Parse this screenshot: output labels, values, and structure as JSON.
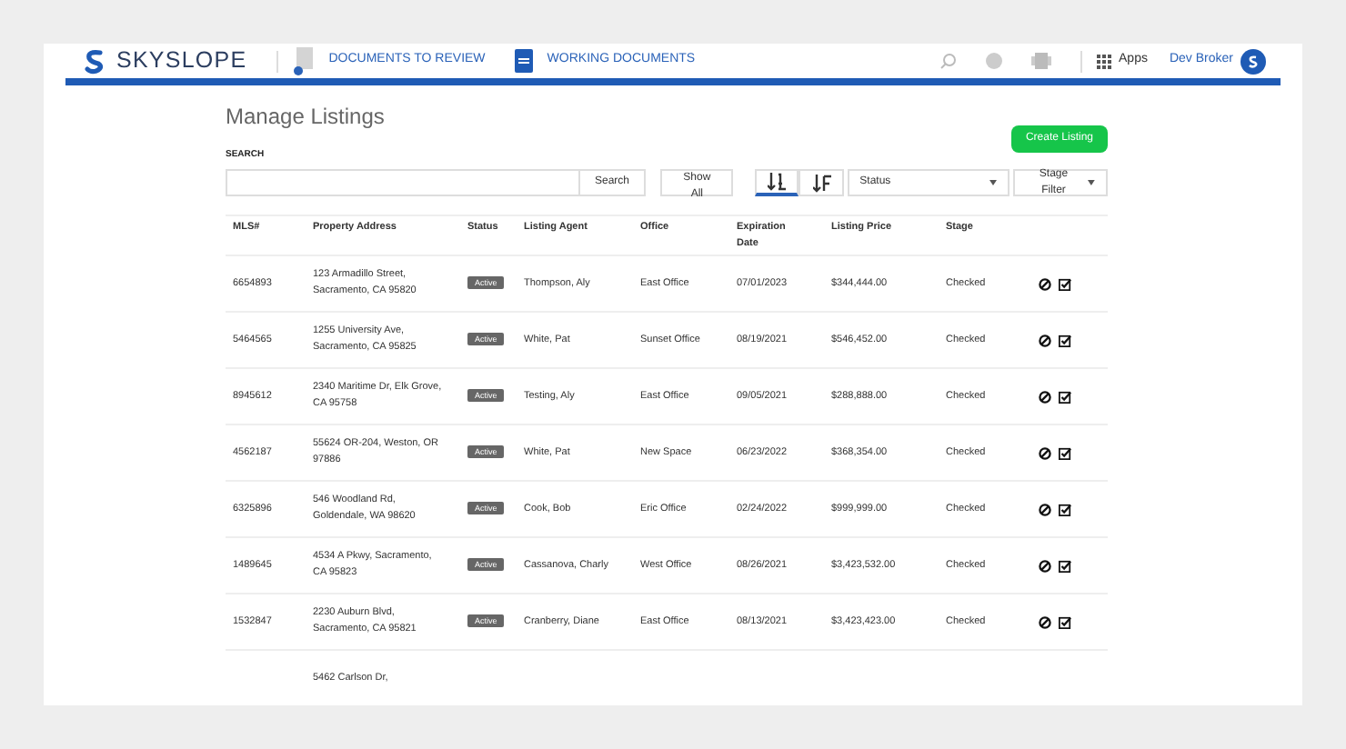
{
  "header": {
    "logo": "SKYSLOPE",
    "nav": [
      {
        "label": "DOCUMENTS TO REVIEW",
        "kind": "review"
      },
      {
        "label": "WORKING DOCUMENTS",
        "kind": "working"
      }
    ],
    "apps": "Apps",
    "user": "Dev Broker"
  },
  "page": {
    "title": "Manage Listings",
    "create_button": "Create Listing",
    "search_label": "SEARCH",
    "search_button": "Search",
    "show_all": "Show All",
    "sort_buttons": [
      {
        "kind": "asc",
        "selected": true
      },
      {
        "kind": "desc",
        "selected": false
      }
    ],
    "status_select": "Status",
    "stage_filter": "Stage Filter"
  },
  "table": {
    "columns": [
      [
        "MLS#"
      ],
      [
        "Property Address"
      ],
      [
        "Status"
      ],
      [
        "Listing Agent"
      ],
      [
        "Office"
      ],
      [
        "Expiration",
        "Date"
      ],
      [
        "Listing Price"
      ],
      [
        "Stage"
      ]
    ],
    "rows": [
      {
        "mls": "6654893",
        "address": [
          "123 Armadillo Street,",
          "Sacramento, CA 95820"
        ],
        "status": "Active",
        "agent": "Thompson, Aly",
        "office": "East Office",
        "expiration": "07/01/2023",
        "price": "$344,444.00",
        "stage": "Checked"
      },
      {
        "mls": "5464565",
        "address": [
          "1255 University Ave,",
          "Sacramento, CA 95825"
        ],
        "status": "Active",
        "agent": "White, Pat",
        "office": "Sunset Office",
        "expiration": "08/19/2021",
        "price": "$546,452.00",
        "stage": "Checked"
      },
      {
        "mls": "8945612",
        "address": [
          "2340 Maritime Dr, Elk Grove,",
          "CA 95758"
        ],
        "status": "Active",
        "agent": "Testing, Aly",
        "office": "East Office",
        "expiration": "09/05/2021",
        "price": "$288,888.00",
        "stage": "Checked"
      },
      {
        "mls": "4562187",
        "address": [
          "55624 OR-204, Weston, OR",
          "97886"
        ],
        "status": "Active",
        "agent": "White, Pat",
        "office": "New Space",
        "expiration": "06/23/2022",
        "price": "$368,354.00",
        "stage": "Checked"
      },
      {
        "mls": "6325896",
        "address": [
          "546 Woodland Rd,",
          "Goldendale, WA 98620"
        ],
        "status": "Active",
        "agent": "Cook, Bob",
        "office": "Eric Office",
        "expiration": "02/24/2022",
        "price": "$999,999.00",
        "stage": "Checked"
      },
      {
        "mls": "1489645",
        "address": [
          "4534 A Pkwy, Sacramento,",
          "CA 95823"
        ],
        "status": "Active",
        "agent": "Cassanova, Charly",
        "office": "West Office",
        "expiration": "08/26/2021",
        "price": "$3,423,532.00",
        "stage": "Checked"
      },
      {
        "mls": "1532847",
        "address": [
          "2230 Auburn Blvd,",
          "Sacramento, CA 95821"
        ],
        "status": "Active",
        "agent": "Cranberry, Diane",
        "office": "East Office",
        "expiration": "08/13/2021",
        "price": "$3,423,423.00",
        "stage": "Checked"
      },
      {
        "address": [
          "5462 Carlson Dr,"
        ]
      }
    ]
  }
}
